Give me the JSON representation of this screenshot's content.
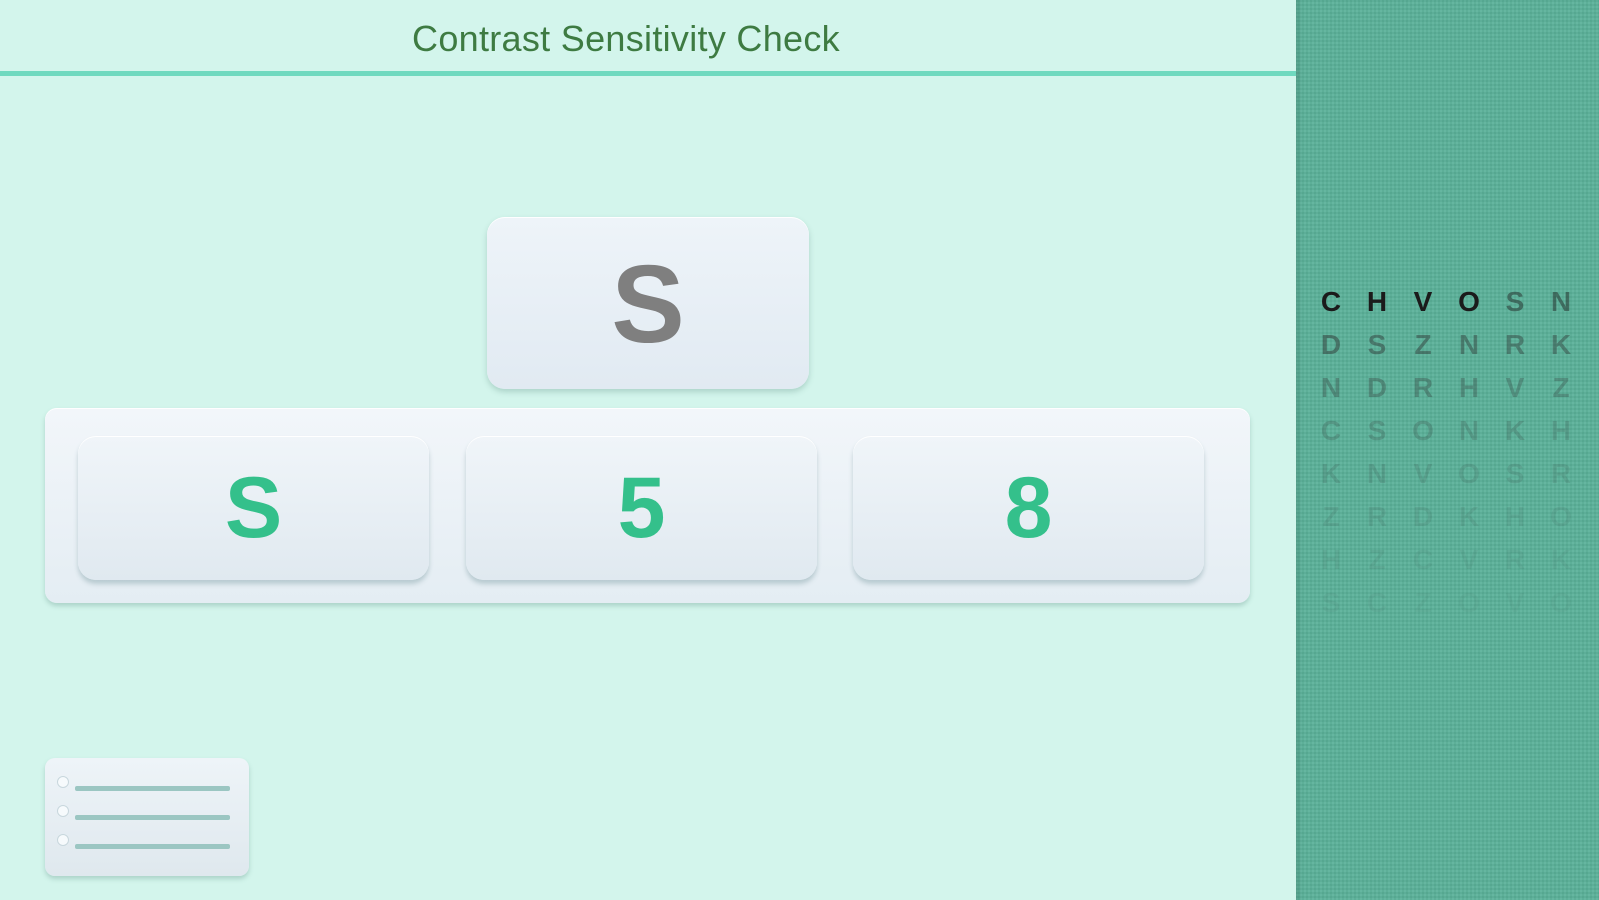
{
  "header": {
    "title": "Contrast Sensitivity Check"
  },
  "target": {
    "letter": "S"
  },
  "choices": [
    {
      "label": "S"
    },
    {
      "label": "5"
    },
    {
      "label": "8"
    }
  ],
  "menu": {
    "icon": "list-icon"
  },
  "contrast_chart": {
    "rows": [
      {
        "letters": [
          "C",
          "H",
          "V",
          "O",
          "S",
          "N"
        ],
        "color": "#1b1b1b",
        "opacity": [
          1,
          1,
          1,
          1,
          0.45,
          0.45
        ]
      },
      {
        "letters": [
          "D",
          "S",
          "Z",
          "N",
          "R",
          "K"
        ],
        "color": "#2b2b2b",
        "opacity": [
          0.45,
          0.42,
          0.42,
          0.4,
          0.38,
          0.38
        ]
      },
      {
        "letters": [
          "N",
          "D",
          "R",
          "H",
          "V",
          "Z"
        ],
        "color": "#2b2b2b",
        "opacity": [
          0.3,
          0.3,
          0.3,
          0.28,
          0.26,
          0.26
        ]
      },
      {
        "letters": [
          "C",
          "S",
          "O",
          "N",
          "K",
          "H"
        ],
        "color": "#2b2b2b",
        "opacity": [
          0.2,
          0.2,
          0.2,
          0.18,
          0.18,
          0.16
        ]
      },
      {
        "letters": [
          "K",
          "N",
          "V",
          "O",
          "S",
          "R"
        ],
        "color": "#2b2b2b",
        "opacity": [
          0.14,
          0.14,
          0.13,
          0.12,
          0.12,
          0.11
        ]
      },
      {
        "letters": [
          "Z",
          "R",
          "D",
          "K",
          "H",
          "O"
        ],
        "color": "#2b2b2b",
        "opacity": [
          0.1,
          0.1,
          0.09,
          0.09,
          0.08,
          0.08
        ]
      },
      {
        "letters": [
          "H",
          "Z",
          "C",
          "V",
          "R",
          "K"
        ],
        "color": "#2b2b2b",
        "opacity": [
          0.07,
          0.07,
          0.06,
          0.06,
          0.06,
          0.05
        ]
      },
      {
        "letters": [
          "S",
          "C",
          "Z",
          "O",
          "V",
          "O"
        ],
        "color": "#2b2b2b",
        "opacity": [
          0.05,
          0.05,
          0.04,
          0.04,
          0.04,
          0.04
        ]
      }
    ]
  },
  "colors": {
    "background": "#d3f5ec",
    "accent_line": "#6fd9bf",
    "title": "#3e7b42",
    "choice_text": "#34c08b",
    "target_text": "#7f7f7f",
    "side_panel": "#5bb29a"
  }
}
